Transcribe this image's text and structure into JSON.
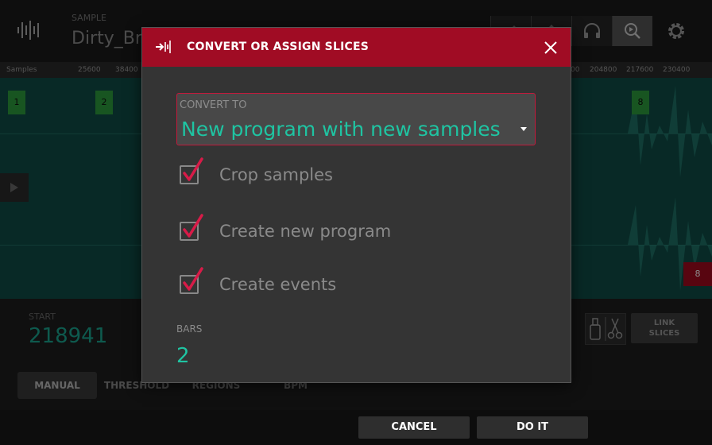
{
  "background": {
    "sample_label": "SAMPLE",
    "sample_name": "Dirty_Bre",
    "ruler_label": "Samples",
    "ruler_ticks": [
      "25600",
      "38400",
      "00",
      "204800",
      "217600",
      "230400"
    ],
    "slice_markers": [
      "1",
      "2",
      "8"
    ],
    "red_marker": "8",
    "start_label": "START",
    "start_value": "218941",
    "mode_tabs": [
      "MANUAL",
      "THRESHOLD",
      "REGIONS",
      "BPM"
    ],
    "link_slices_line1": "LINK",
    "link_slices_line2": "SLICES"
  },
  "dialog": {
    "title": "CONVERT OR ASSIGN SLICES",
    "convert_label": "CONVERT TO",
    "convert_value": "New program with new samples",
    "options": [
      {
        "label": "Crop samples",
        "checked": true
      },
      {
        "label": "Create new program",
        "checked": true
      },
      {
        "label": "Create events",
        "checked": true
      }
    ],
    "bars_label": "BARS",
    "bars_value": "2"
  },
  "footer": {
    "cancel_label": "CANCEL",
    "do_it_label": "DO IT"
  },
  "colors": {
    "accent_red": "#a00c24",
    "teal_value": "#1fc4a2",
    "check_red": "#d81b48"
  }
}
